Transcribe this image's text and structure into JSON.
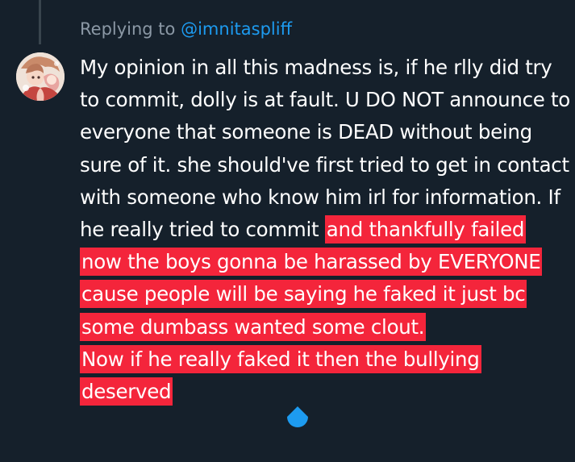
{
  "reply": {
    "prefix": "Replying to",
    "handle": "@imnitaspliff"
  },
  "tweet": {
    "line1_plain": "My opinion in all this madness is, if he rlly did try to commit, dolly is at fault. U DO NOT announce to everyone that someone is DEAD without being sure of it. she should've first tried to get in contact with someone who know him irl for information. If he really tried to commit ",
    "line1_highlighted": "and thankfully failed now the boys gonna be harassed by EVERYONE cause people will be saying he faked it just bc some dumbass wanted some clout.",
    "line2_highlighted": "Now if he really faked it then the bullying deserved"
  },
  "colors": {
    "background": "#15202b",
    "highlight": "#f4253b",
    "link": "#1d9bf0",
    "muted": "#8b98a5"
  },
  "icons": {
    "avatar": "anime-avatar",
    "selection_handle": "text-selection-handle"
  }
}
